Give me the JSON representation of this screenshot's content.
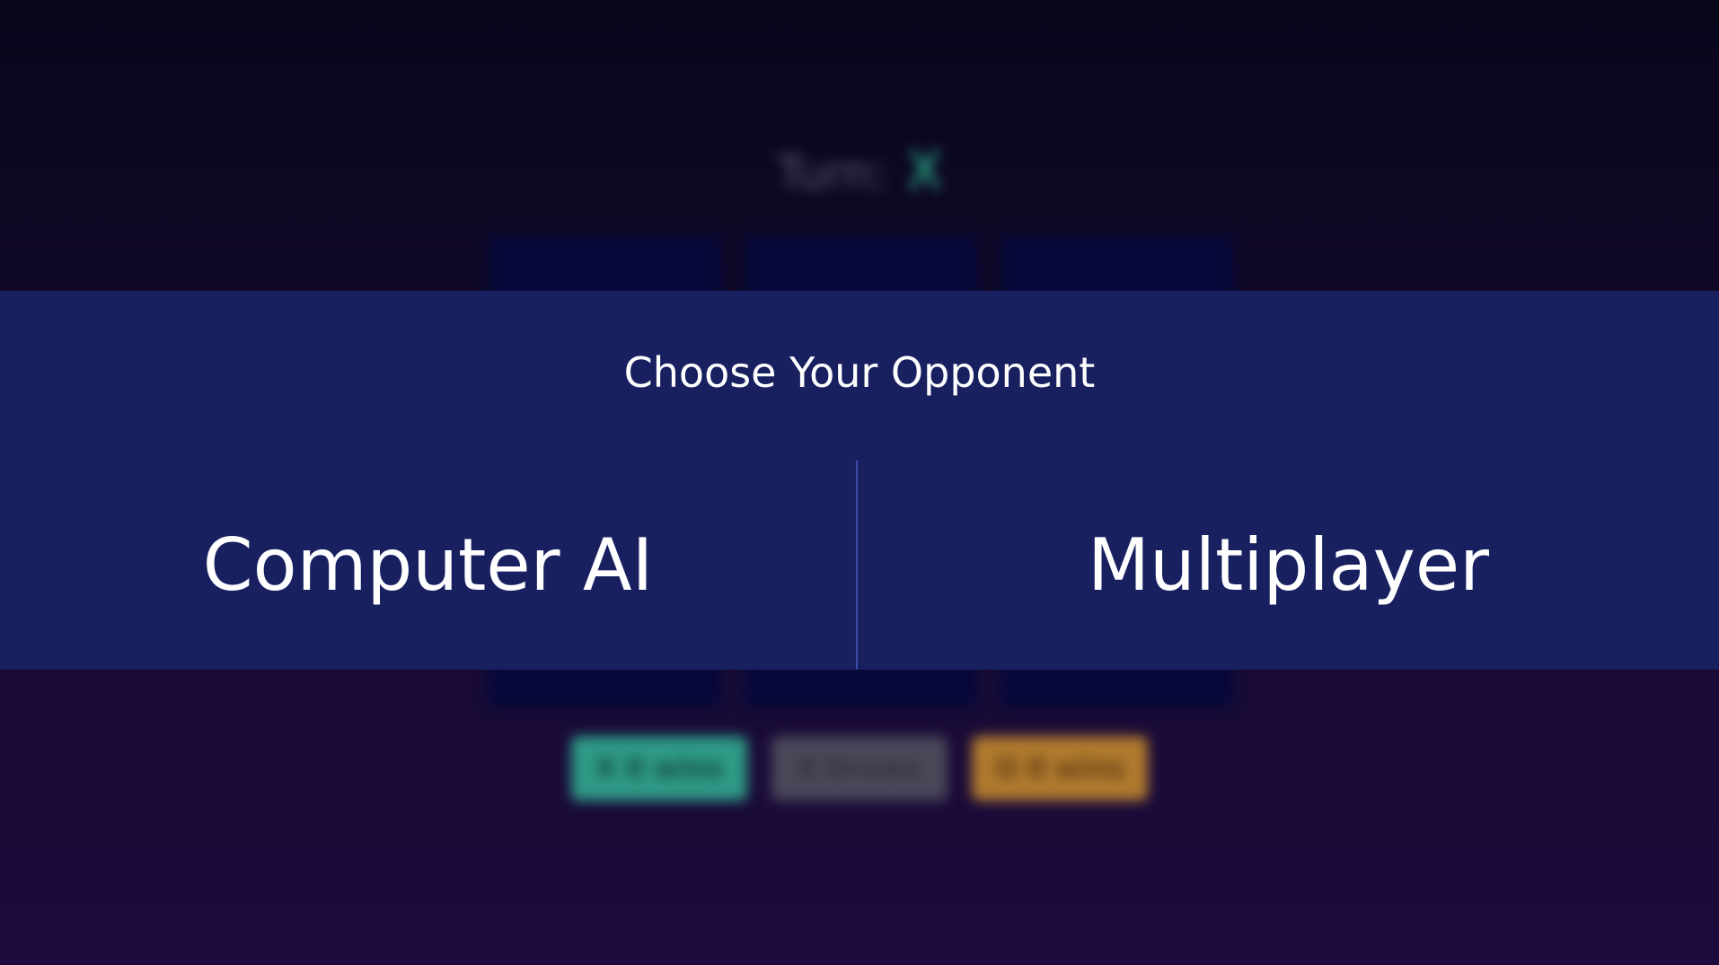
{
  "game": {
    "turn_label": "Turn:",
    "turn_mark": "X",
    "board": [
      "",
      "",
      "",
      "",
      "",
      "",
      "",
      "",
      ""
    ],
    "scores": {
      "x": "X 0 wins",
      "draws": "0 Draws",
      "o": "O 0 wins"
    }
  },
  "modal": {
    "title": "Choose Your Opponent",
    "option_ai": "Computer AI",
    "option_multiplayer": "Multiplayer"
  },
  "colors": {
    "modal_bg": "#182060",
    "x_color": "#2fb890",
    "o_color": "#b07a2e",
    "cell_bg": "#06093a"
  }
}
